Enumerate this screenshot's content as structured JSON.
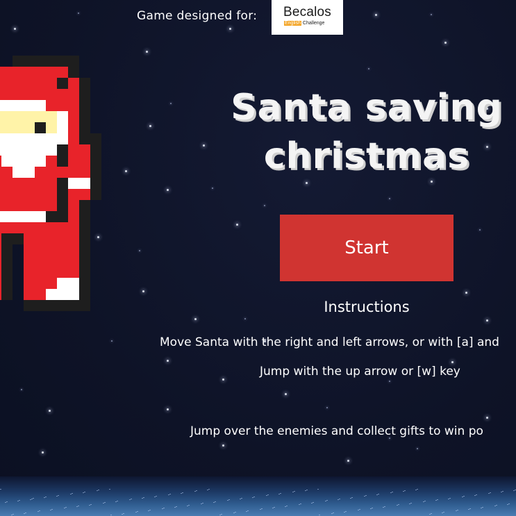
{
  "header": {
    "designed_for_label": "Game designed for:",
    "logo_brand": "Becalos",
    "logo_sub_highlight": "English",
    "logo_sub_rest": "Challenge"
  },
  "game": {
    "title_line1": "Santa saving",
    "title_line2": "christmas",
    "start_label": "Start"
  },
  "instructions": {
    "title": "Instructions",
    "lines": [
      "Move Santa with the right and left arrows, or with [a] and",
      "Jump with the up arrow or [w] key",
      "Jump over the enemies and collect gifts to win po"
    ]
  },
  "colors": {
    "background": "#0f1428",
    "start_button": "#d03431",
    "santa_red": "#e8232a",
    "santa_skin": "#fff3a8",
    "logo_highlight": "#f3a11d"
  },
  "icons": {
    "character": "santa-pixel-sprite",
    "logo": "becalos-logo"
  }
}
